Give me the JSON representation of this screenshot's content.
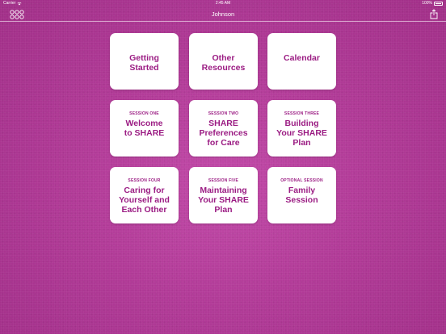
{
  "status_bar": {
    "carrier": "Carrier",
    "time": "2:45 AM",
    "battery": "100%"
  },
  "nav": {
    "title": "Johnson",
    "left_icon": "grid-dots-icon",
    "right_icon": "share-icon"
  },
  "colors": {
    "background": "#b23b98",
    "accent_text": "#9b1c83",
    "tile": "#ffffff"
  },
  "tiles": [
    {
      "session": "",
      "title": "Getting\nStarted"
    },
    {
      "session": "",
      "title": "Other\nResources"
    },
    {
      "session": "",
      "title": "Calendar"
    },
    {
      "session": "SESSION ONE",
      "title": "Welcome\nto SHARE"
    },
    {
      "session": "SESSION TWO",
      "title": "SHARE\nPreferences\nfor Care"
    },
    {
      "session": "SESSION THREE",
      "title": "Building\nYour SHARE\nPlan"
    },
    {
      "session": "SESSION FOUR",
      "title": "Caring for\nYourself and\nEach Other"
    },
    {
      "session": "SESSION FIVE",
      "title": "Maintaining\nYour SHARE\nPlan"
    },
    {
      "session": "OPTIONAL SESSION",
      "title": "Family\nSession"
    }
  ]
}
